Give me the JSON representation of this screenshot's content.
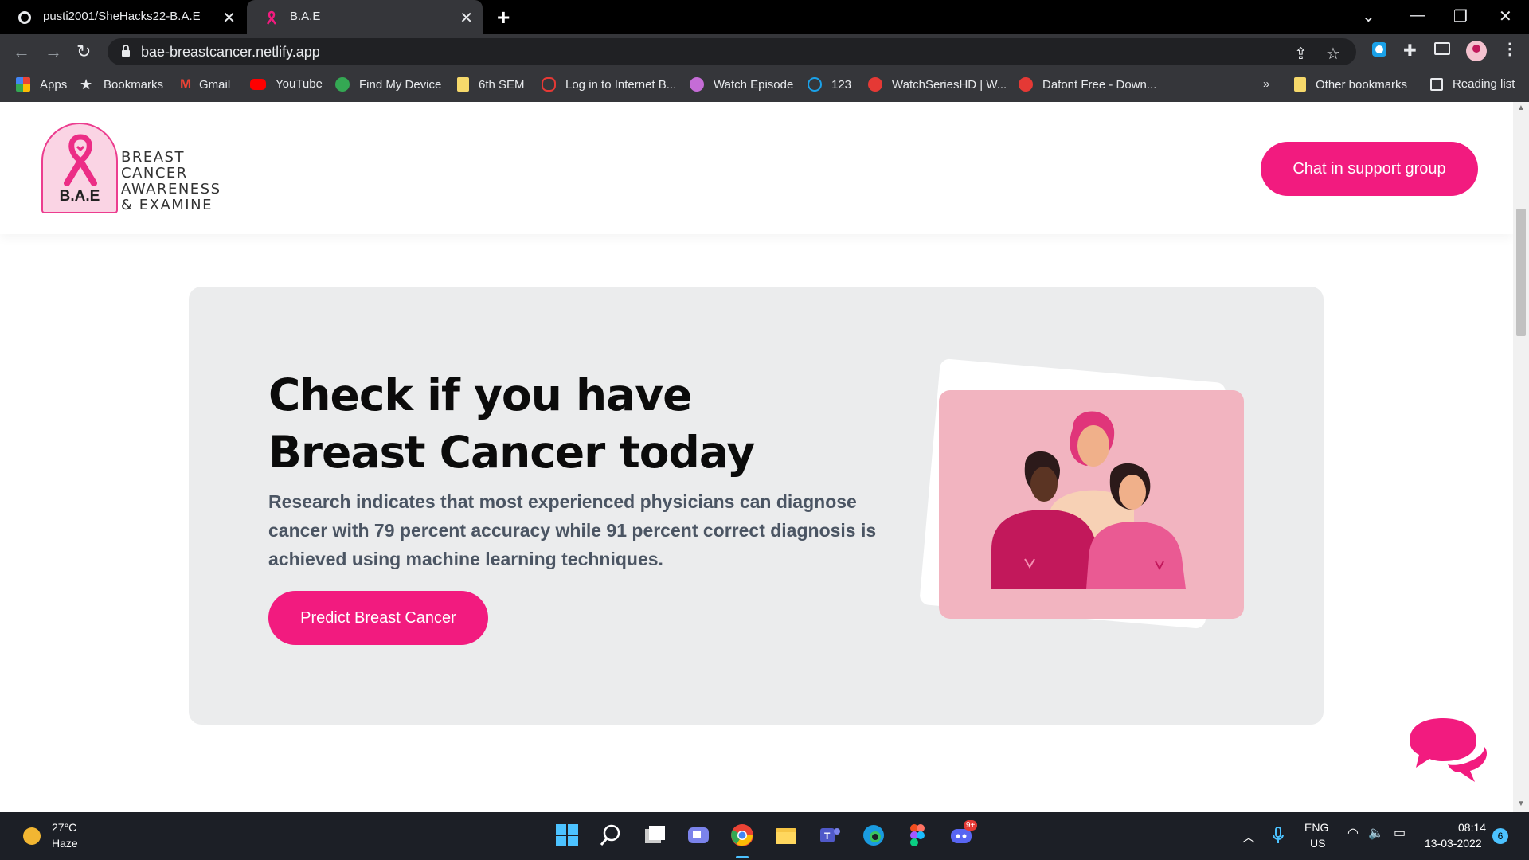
{
  "browser": {
    "tabs": [
      {
        "title": "pusti2001/SheHacks22-B.A.E",
        "active": false
      },
      {
        "title": "B.A.E",
        "active": true
      }
    ],
    "url": "bae-breastcancer.netlify.app",
    "bookmarks": [
      {
        "label": "Apps",
        "icon": "apps-grid-icon"
      },
      {
        "label": "Bookmarks",
        "icon": "star-icon"
      },
      {
        "label": "Gmail",
        "icon": "gmail-icon"
      },
      {
        "label": "YouTube",
        "icon": "youtube-icon"
      },
      {
        "label": "Find My Device",
        "icon": "find-device-icon"
      },
      {
        "label": "6th SEM",
        "icon": "folder-icon"
      },
      {
        "label": "Log in to Internet B...",
        "icon": "link-icon"
      },
      {
        "label": "Watch Episode",
        "icon": "play-icon"
      },
      {
        "label": "123",
        "icon": "play-circle-icon"
      },
      {
        "label": "WatchSeriesHD | W...",
        "icon": "play-red-icon"
      },
      {
        "label": "Dafont Free - Down...",
        "icon": "dafont-icon"
      }
    ],
    "overflow": "»",
    "other_bookmarks": "Other bookmarks",
    "reading_list": "Reading list"
  },
  "site": {
    "logo": {
      "badge": "B.A.E",
      "line1": "BREAST",
      "line2": "CANCER",
      "line3": "AWARENESS",
      "line4": "& EXAMINE"
    },
    "chat_button": "Chat in support group",
    "hero": {
      "title": "Check if you have Breast Cancer today",
      "description": "Research indicates that most experienced physicians can diagnose cancer with 79 percent accuracy while 91 percent correct diagnosis is achieved using machine learning techniques.",
      "button": "Predict Breast Cancer"
    },
    "colors": {
      "accent": "#f21b7f",
      "hero_bg": "#ebeced",
      "illustration_bg": "#f2b4c0"
    }
  },
  "taskbar": {
    "weather": {
      "temp": "27°C",
      "desc": "Haze"
    },
    "language": {
      "lang": "ENG",
      "region": "US"
    },
    "clock": {
      "time": "08:14",
      "date": "13-03-2022"
    },
    "notifications": "6",
    "discord_badge": "9+"
  }
}
